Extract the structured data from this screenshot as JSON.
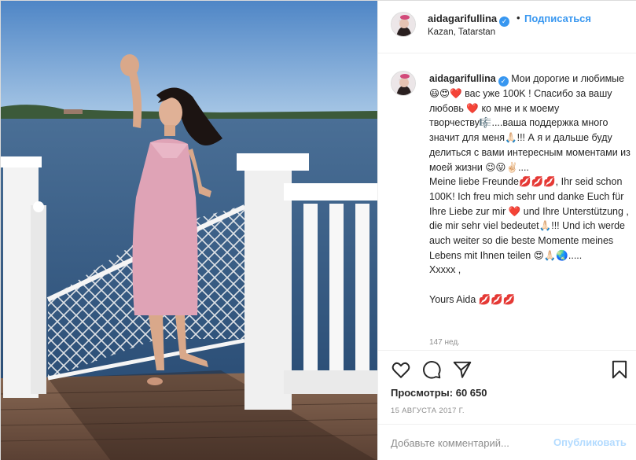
{
  "header": {
    "username": "aidagarifullina",
    "separator": "•",
    "follow_label": "Подписаться",
    "location": "Kazan, Tatarstan"
  },
  "caption": {
    "username": "aidagarifullina",
    "text": "Мои дорогие и любимые😃😍❤️ вас уже 100K ! Спасибо за вашу любовь ❤️ ко мне и к моему творчеству🎼....ваша поддержка много значит для меня🙏🏻!!! А я и дальше буду делиться с вами интересным моментами из моей жизни 😉😛✌🏻....\nMeine liebe Freunde💋💋💋, Ihr seid schon 100K! Ich freu mich sehr und danke Euch für Ihre Liebe zur mir ❤️ und Ihre Unterstützung , die mir sehr viel bedeutet🙏🏻!!! Und ich werde auch weiter so die beste Momente meines Lebens mit Ihnen teilen 😍🙏🏻🌏.....\nXxxxx ,\n\nYours Aida 💋💋💋",
    "age": "147 нед."
  },
  "actions": {
    "like_icon": "heart-icon",
    "comment_icon": "comment-icon",
    "share_icon": "share-icon",
    "save_icon": "bookmark-icon"
  },
  "stats": {
    "views_label": "Просмотры:",
    "views_value": "60 650",
    "date": "15 АВГУСТА 2017 Г."
  },
  "comment": {
    "placeholder": "Добавьте комментарий...",
    "publish_label": "Опубликовать"
  },
  "colors": {
    "accent": "#3897f0",
    "publish_disabled": "#b3dbff",
    "muted_text": "#8e8e8e"
  }
}
